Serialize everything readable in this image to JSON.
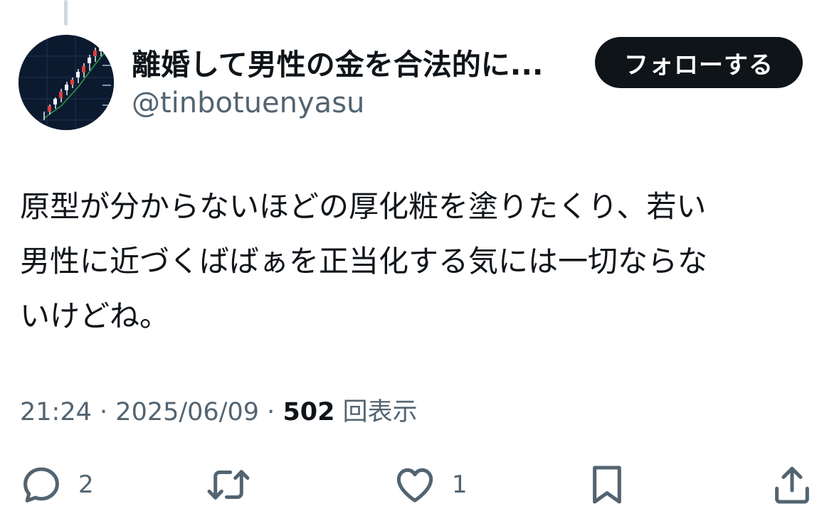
{
  "post": {
    "author": {
      "display_name": "離婚して男性の金を合法的に...",
      "handle": "@tinbotuenyasu",
      "avatar": "stock-chart-avatar"
    },
    "follow_label": "フォローする",
    "text": "原型が分からないほどの厚化粧を塗りたくり、若い\n男性に近づくばばぁを正当化する気には一切ならな\nいけどね。",
    "time": "21:24",
    "separator": "·",
    "date": "2025/06/09",
    "views_count": "502",
    "views_label": "回表示"
  },
  "actions": {
    "reply": {
      "icon": "reply-icon",
      "count": "2"
    },
    "repost": {
      "icon": "repost-icon",
      "count": ""
    },
    "like": {
      "icon": "heart-icon",
      "count": "1"
    },
    "bookmark": {
      "icon": "bookmark-icon",
      "count": ""
    },
    "share": {
      "icon": "share-icon",
      "count": ""
    }
  },
  "colors": {
    "text": "#0f1419",
    "secondary": "#536471",
    "button_bg": "#0f1419",
    "button_text": "#ffffff"
  }
}
